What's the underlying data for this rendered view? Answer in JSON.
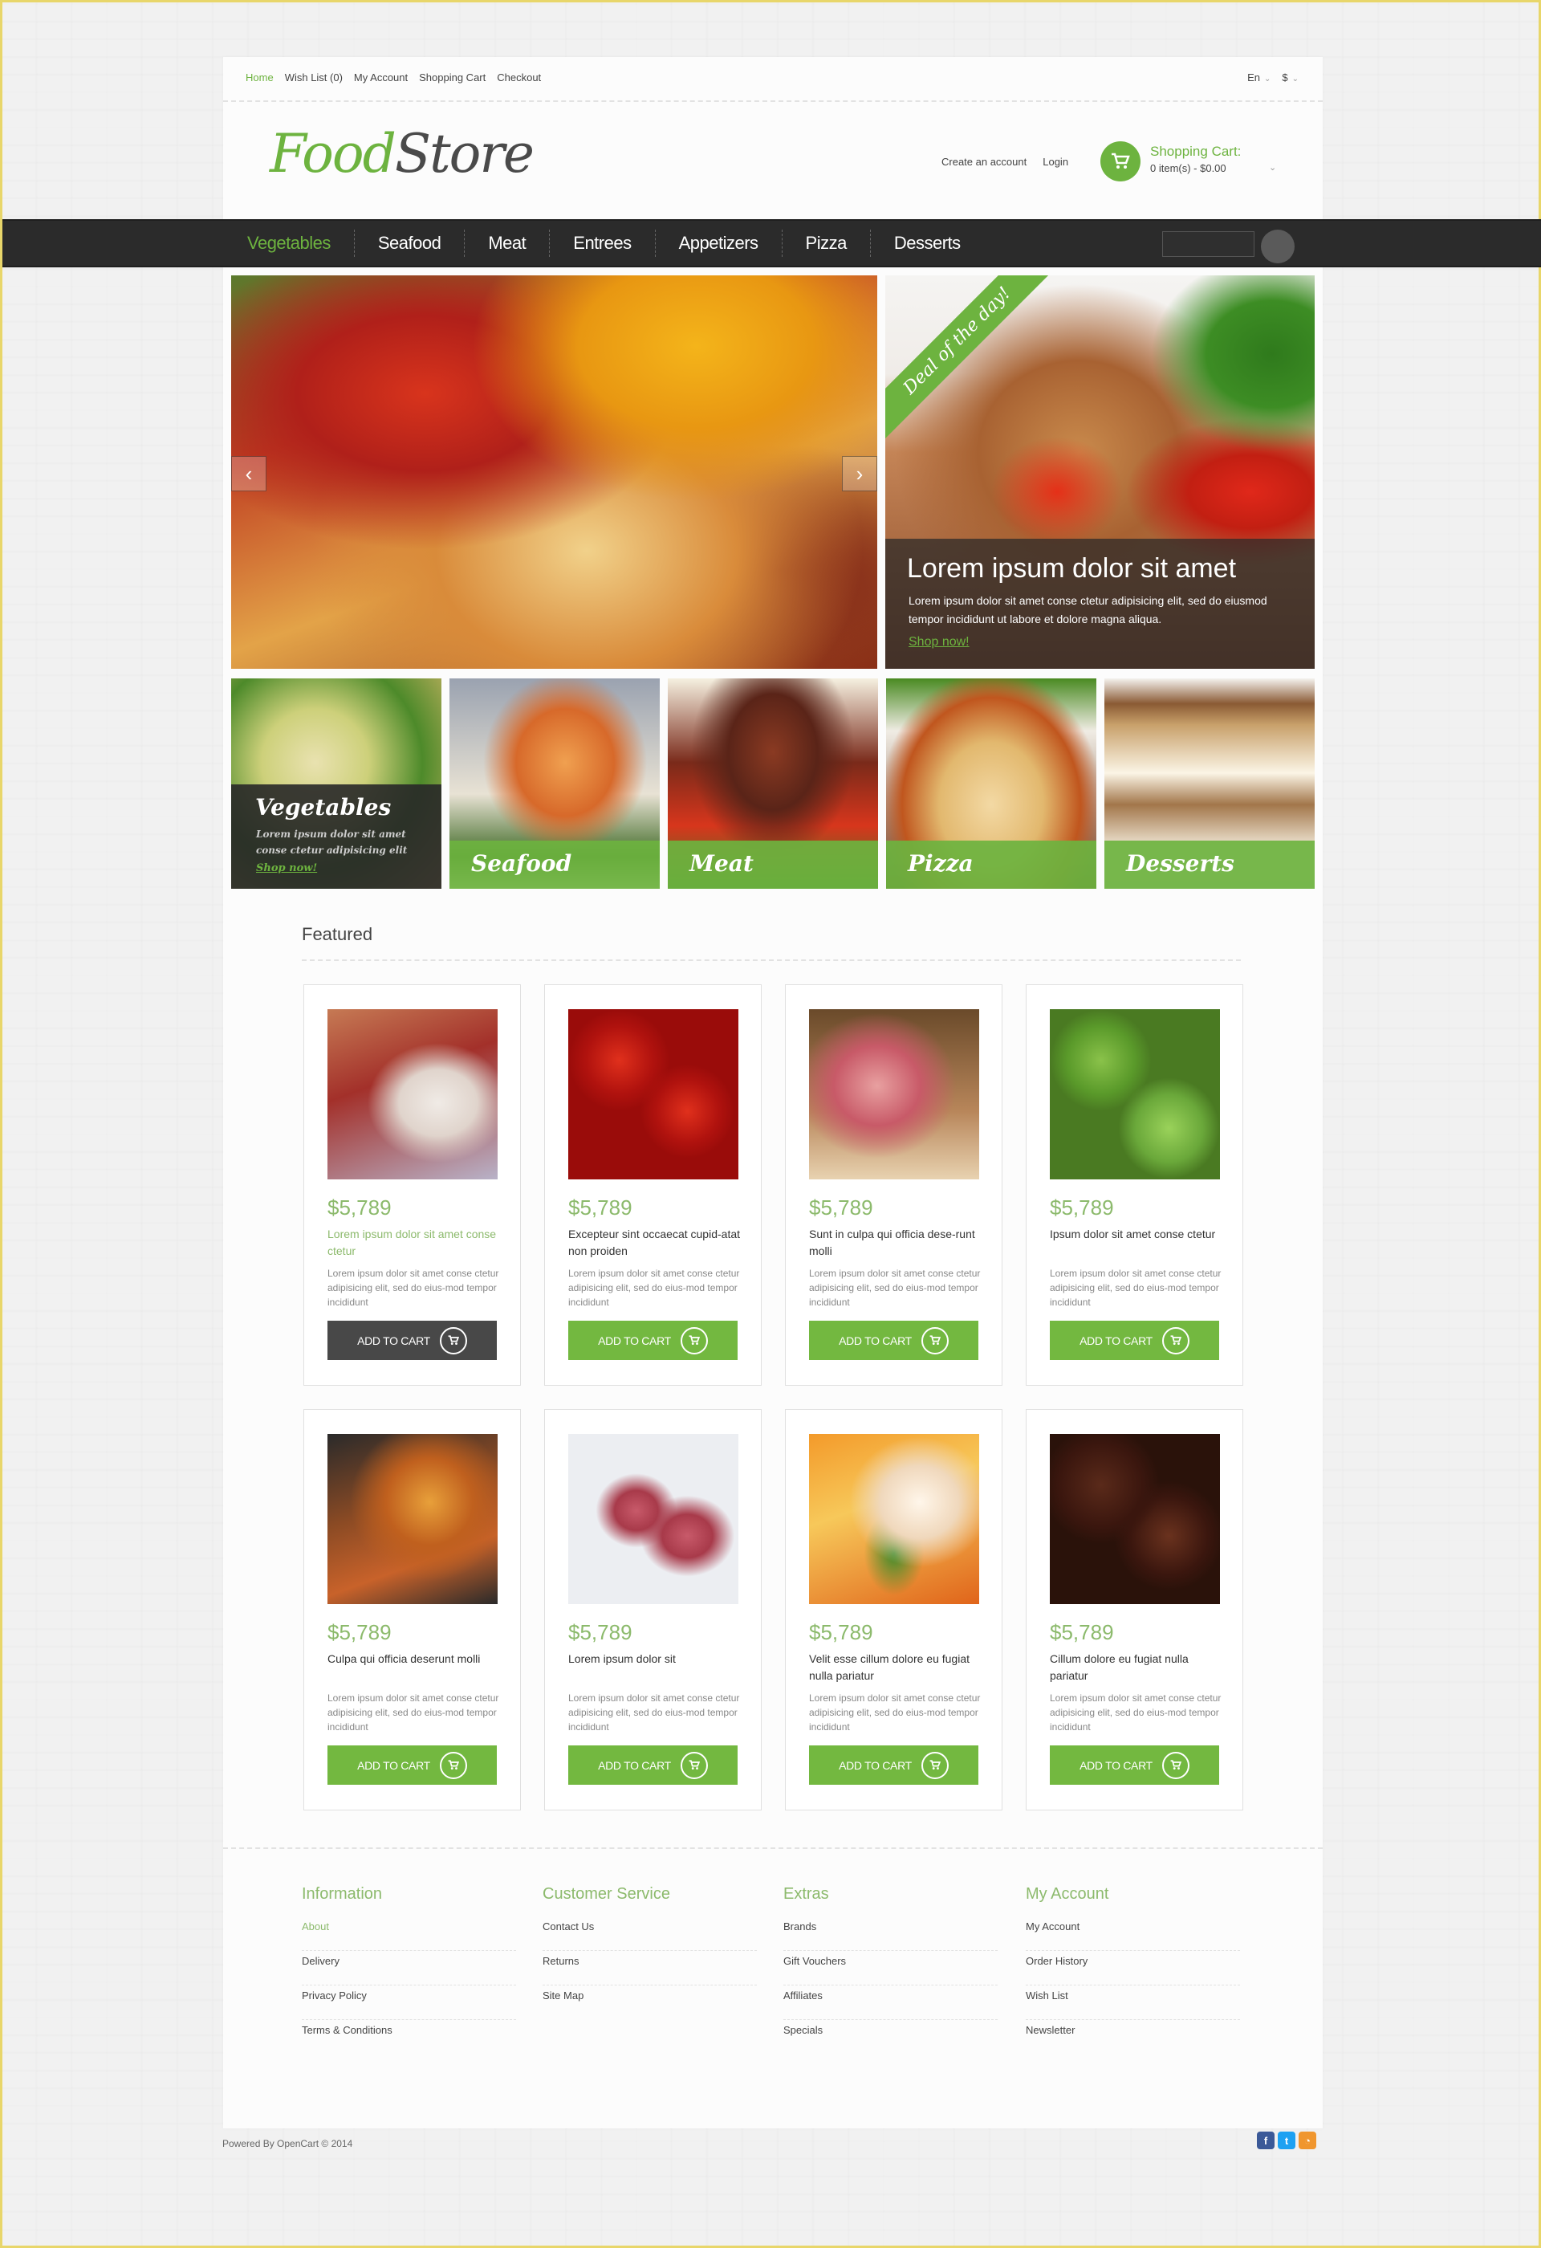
{
  "top_links": [
    "Home",
    "Wish List (0)",
    "My Account",
    "Shopping Cart",
    "Checkout"
  ],
  "language": "En",
  "currency": "$",
  "logo": {
    "part1": "Food",
    "part2": "Store"
  },
  "account_links": [
    "Create an account",
    "Login"
  ],
  "cart": {
    "title": "Shopping Cart:",
    "summary": "0 item(s) - $0.00"
  },
  "nav": [
    "Vegetables",
    "Seafood",
    "Meat",
    "Entrees",
    "Appetizers",
    "Pizza",
    "Desserts"
  ],
  "search": {
    "placeholder": ""
  },
  "slider": {
    "prev": "‹",
    "next": "›"
  },
  "deal": {
    "ribbon": "Deal of the day!",
    "title": "Lorem ipsum dolor sit amet",
    "text": "Lorem ipsum dolor sit amet conse ctetur adipisicing elit, sed do eiusmod tempor incididunt ut labore et dolore magna aliqua.",
    "link": "Shop now!"
  },
  "categories": [
    {
      "name": "Vegetables",
      "text": "Lorem ipsum dolor sit amet conse ctetur adipisicing elit",
      "link": "Shop now!"
    },
    {
      "name": "Seafood"
    },
    {
      "name": "Meat"
    },
    {
      "name": "Pizza"
    },
    {
      "name": "Desserts"
    }
  ],
  "featured": {
    "title": "Featured",
    "button_label": "ADD TO CART",
    "products": [
      {
        "price": "$5,789",
        "name": "Lorem ipsum dolor sit amet conse ctetur",
        "desc": "Lorem ipsum dolor sit amet conse ctetur adipisicing elit, sed do eius-mod tempor incididunt"
      },
      {
        "price": "$5,789",
        "name": "Excepteur sint occaecat cupid-atat non proiden",
        "desc": "Lorem ipsum dolor sit amet conse ctetur adipisicing elit, sed do eius-mod tempor incididunt"
      },
      {
        "price": "$5,789",
        "name": "Sunt in culpa qui officia dese-runt molli",
        "desc": "Lorem ipsum dolor sit amet conse ctetur adipisicing elit, sed do eius-mod tempor incididunt"
      },
      {
        "price": "$5,789",
        "name": "Ipsum dolor sit amet conse ctetur",
        "desc": "Lorem ipsum dolor sit amet conse ctetur adipisicing elit, sed do eius-mod tempor incididunt"
      },
      {
        "price": "$5,789",
        "name": "Culpa qui officia deserunt molli",
        "desc": "Lorem ipsum dolor sit amet conse ctetur adipisicing elit, sed do eius-mod tempor incididunt"
      },
      {
        "price": "$5,789",
        "name": "Lorem ipsum dolor sit",
        "desc": "Lorem ipsum dolor sit amet conse ctetur adipisicing elit, sed do eius-mod tempor incididunt"
      },
      {
        "price": "$5,789",
        "name": "Velit esse cillum dolore eu fugiat nulla pariatur",
        "desc": "Lorem ipsum dolor sit amet conse ctetur adipisicing elit, sed do eius-mod tempor incididunt"
      },
      {
        "price": "$5,789",
        "name": "Cillum dolore eu fugiat nulla pariatur",
        "desc": "Lorem ipsum dolor sit amet conse ctetur adipisicing elit, sed do eius-mod tempor incididunt"
      }
    ]
  },
  "footer": {
    "columns": [
      {
        "title": "Information",
        "links": [
          "About",
          "Delivery",
          "Privacy Policy",
          "Terms & Conditions"
        ]
      },
      {
        "title": "Customer Service",
        "links": [
          "Contact Us",
          "Returns",
          "Site Map"
        ]
      },
      {
        "title": "Extras",
        "links": [
          "Brands",
          "Gift Vouchers",
          "Affiliates",
          "Specials"
        ]
      },
      {
        "title": "My Account",
        "links": [
          "My Account",
          "Order History",
          "Wish List",
          "Newsletter"
        ]
      }
    ],
    "powered": "Powered By OpenCart © 2014",
    "social": {
      "facebook": "f",
      "twitter": "t",
      "rss": "◔"
    }
  },
  "colors": {
    "accent": "#6db33f",
    "nav_bg": "#2b2b2b",
    "dark_button": "#484848"
  }
}
